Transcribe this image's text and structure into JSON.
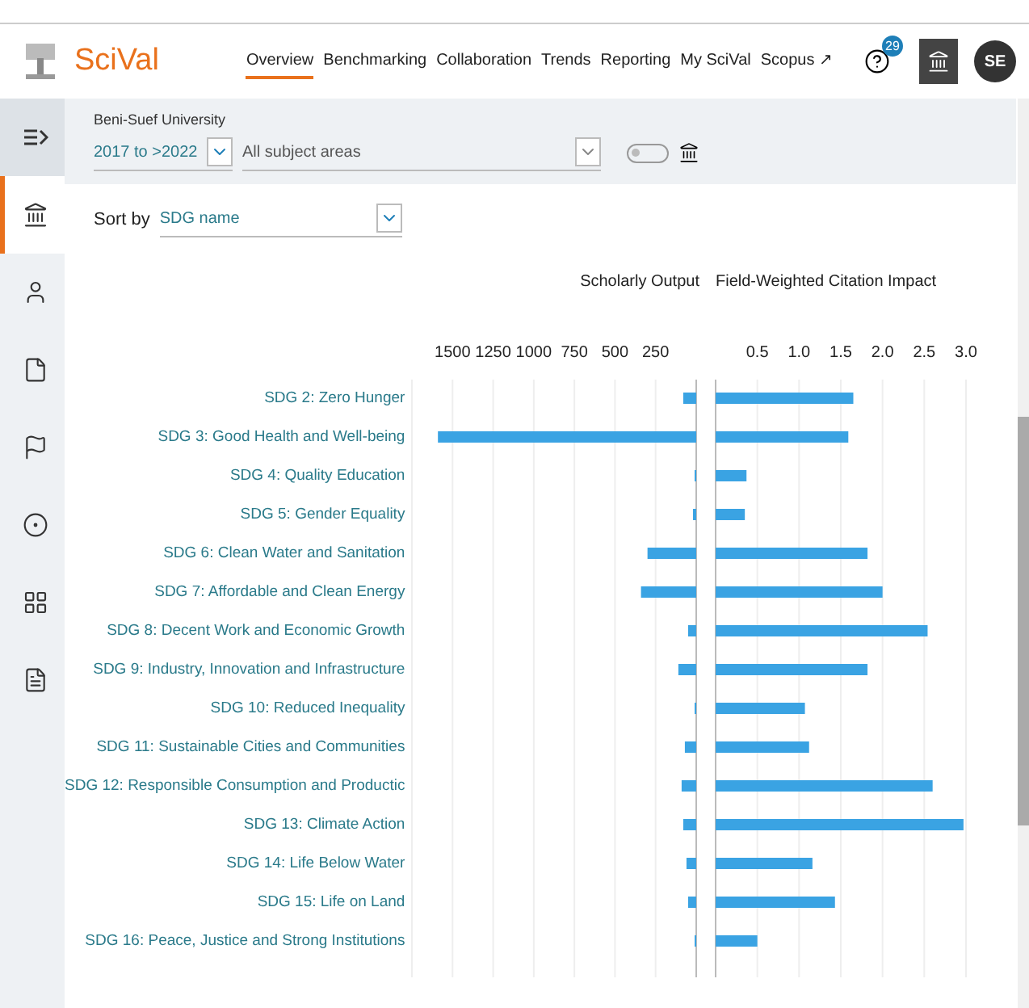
{
  "header": {
    "logo": "SciVal",
    "nav": [
      {
        "label": "Overview",
        "selected": true
      },
      {
        "label": "Benchmarking",
        "selected": false
      },
      {
        "label": "Collaboration",
        "selected": false
      },
      {
        "label": "Trends",
        "selected": false
      },
      {
        "label": "Reporting",
        "selected": false
      },
      {
        "label": "My SciVal",
        "selected": false
      },
      {
        "label": "Scopus ↗",
        "selected": false
      }
    ],
    "help_badge": "29",
    "avatar": "SE"
  },
  "sidebar": {
    "items": [
      {
        "kind": "collapse",
        "selected": false
      },
      {
        "kind": "institution",
        "selected": true
      },
      {
        "kind": "person",
        "selected": false
      },
      {
        "kind": "document",
        "selected": false
      },
      {
        "kind": "flag",
        "selected": false
      },
      {
        "kind": "target",
        "selected": false
      },
      {
        "kind": "grid",
        "selected": false
      },
      {
        "kind": "report",
        "selected": false
      }
    ]
  },
  "filters": {
    "entity": "Beni-Suef University",
    "years": "2017 to >2022",
    "subject": "All subject areas",
    "toggle_on": false
  },
  "sort": {
    "label": "Sort by",
    "value": "SDG name"
  },
  "charts": [
    {
      "chart_data": {
        "type": "bar",
        "orientation": "horizontal",
        "title": "Scholarly Output",
        "grid": true,
        "categories": [
          "SDG 2: Zero Hunger",
          "SDG 3: Good Health and Well-being",
          "SDG 4: Quality Education",
          "SDG 5: Gender Equality",
          "SDG 6: Clean Water and Sanitation",
          "SDG 7: Affordable and Clean Energy",
          "SDG 8: Decent Work and Economic Growth",
          "SDG 9: Industry, Innovation and Infrastructure",
          "SDG 10: Reduced Inequality",
          "SDG 11: Sustainable Cities and Communities",
          "SDG 12: Responsible Consumption and Productic",
          "SDG 13: Climate Action",
          "SDG 14: Life Below Water",
          "SDG 15: Life on Land",
          "SDG 16: Peace, Justice and Strong Institutions"
        ],
        "series": [
          {
            "color": "#3aa3e3",
            "values": [
              80,
              1590,
              10,
              20,
              300,
              340,
              50,
              110,
              10,
              70,
              90,
              80,
              60,
              50,
              10
            ]
          }
        ],
        "xlim": [
          1750,
          0
        ],
        "xticks": [
          250,
          500,
          750,
          1000,
          1250,
          1500
        ]
      }
    },
    {
      "chart_data": {
        "type": "bar",
        "orientation": "horizontal",
        "title": "Field-Weighted Citation Impact",
        "grid": true,
        "series": [
          {
            "color": "#3aa3e3",
            "values": [
              1.65,
              1.59,
              0.37,
              0.35,
              1.82,
              2.0,
              2.54,
              1.82,
              1.07,
              1.12,
              2.6,
              2.97,
              1.16,
              1.43,
              0.5
            ]
          }
        ],
        "xlim": [
          0,
          3
        ],
        "xticks": [
          {
            "value": 0.5,
            "label": "0.5"
          },
          {
            "value": 1,
            "label": "1.0"
          },
          {
            "value": 1.5,
            "label": "1.5"
          },
          {
            "value": 2,
            "label": "2.0"
          },
          {
            "value": 2.5,
            "label": "2.5"
          },
          {
            "value": 3,
            "label": "3.0"
          }
        ]
      }
    }
  ]
}
